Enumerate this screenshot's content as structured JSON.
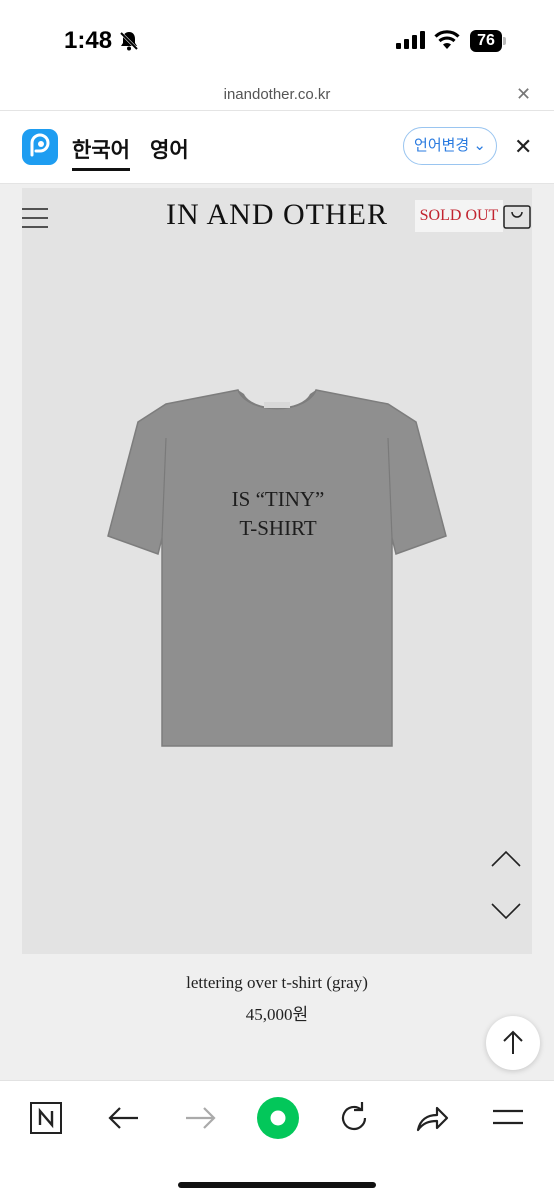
{
  "status_bar": {
    "time": "1:48",
    "battery": "76"
  },
  "browser": {
    "url": "inandother.co.kr"
  },
  "translate_bar": {
    "source_lang": "한국어",
    "target_lang": "영어",
    "change_button": "언어변경 ⌄"
  },
  "site": {
    "brand": "IN AND OTHER",
    "sold_out": "SOLD OUT",
    "shirt_print_line1": "IS “TINY”",
    "shirt_print_line2": "T-SHIRT"
  },
  "product": {
    "name": "lettering over t-shirt (gray)",
    "price": "45,000원"
  },
  "colors": {
    "accent_red": "#c2232f",
    "papago_blue": "#1e9df1",
    "green": "#03c75a"
  }
}
